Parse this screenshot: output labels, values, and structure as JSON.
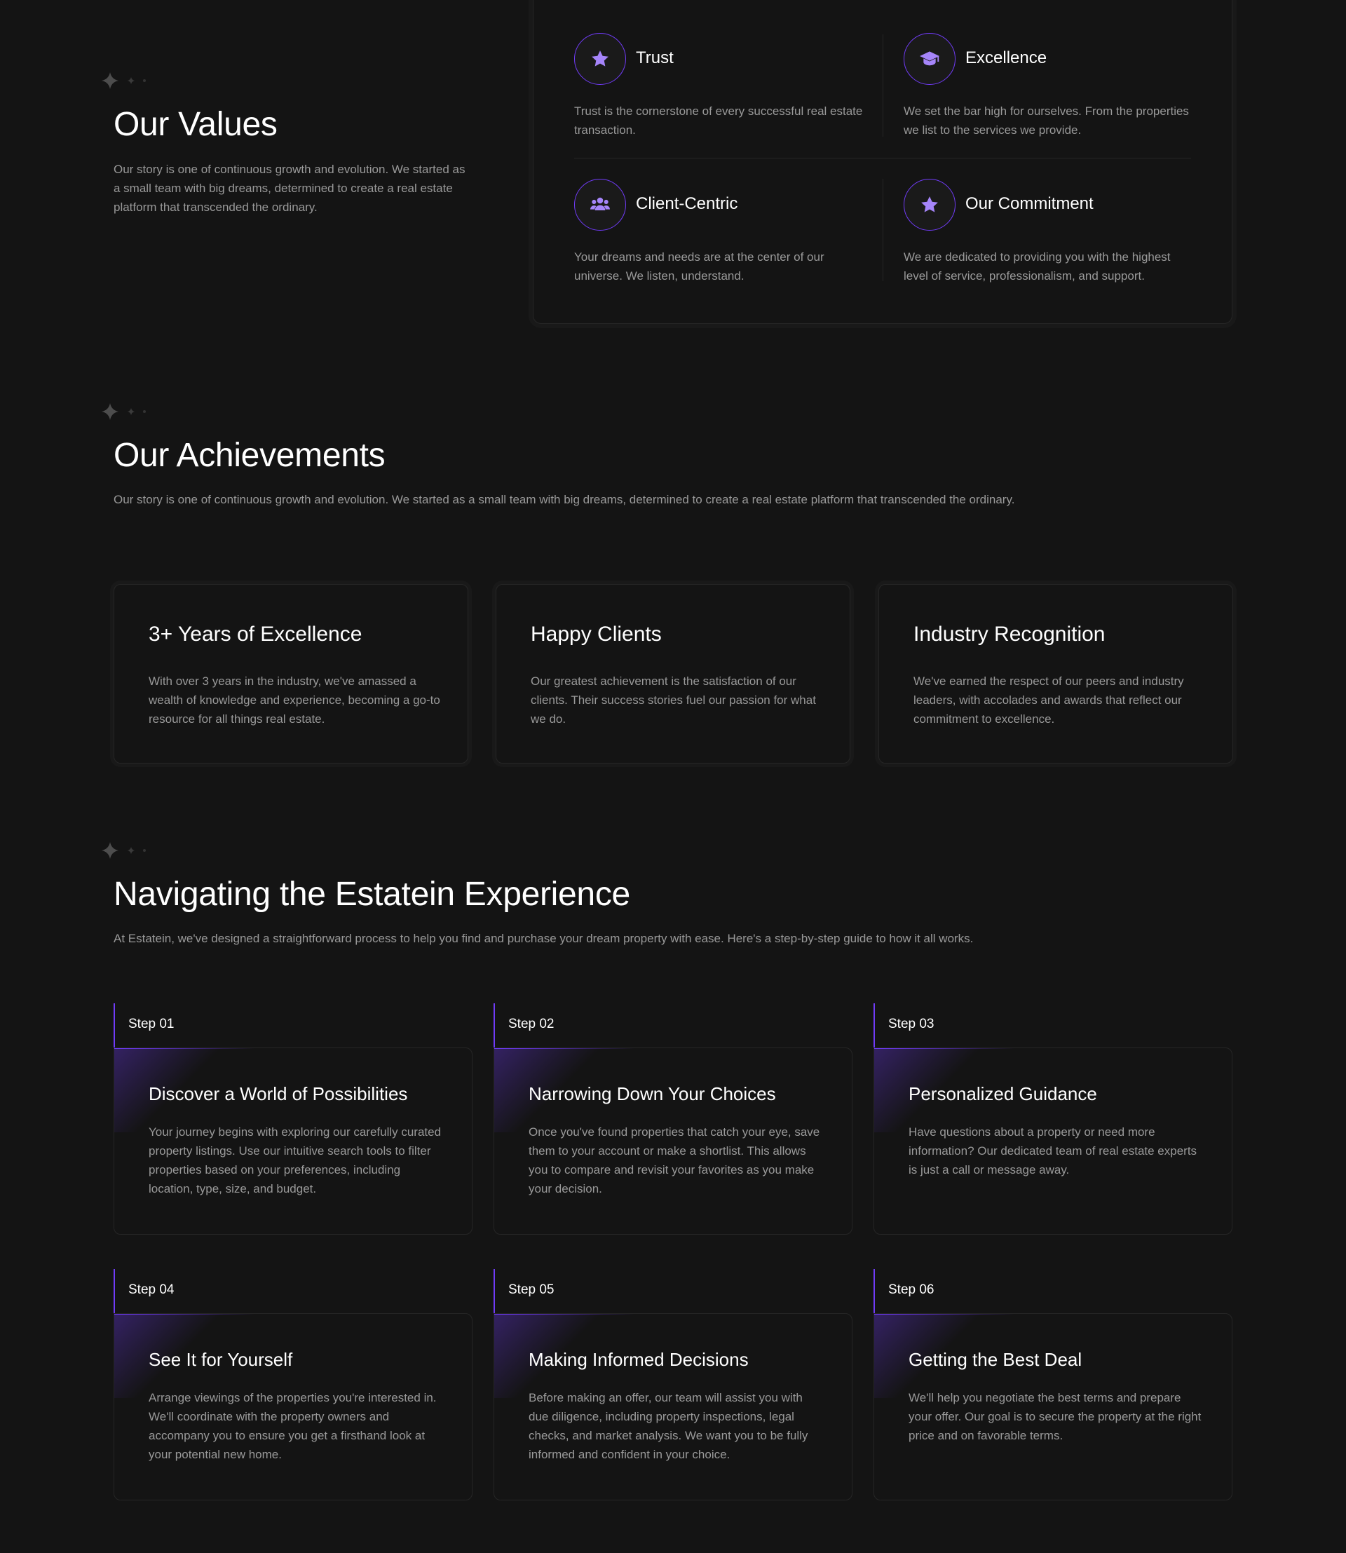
{
  "values": {
    "title": "Our Values",
    "description": "Our story is one of continuous growth and evolution. We started as a small team with big dreams, determined to create a real estate platform that transcended the ordinary.",
    "items": [
      {
        "icon": "star-icon",
        "title": "Trust",
        "description": "Trust is the cornerstone of every successful real estate transaction."
      },
      {
        "icon": "graduation-cap-icon",
        "title": "Excellence",
        "description": "We set the bar high for ourselves. From the properties we list to the services we provide."
      },
      {
        "icon": "users-icon",
        "title": "Client-Centric",
        "description": "Your dreams and needs are at the center of our universe. We listen, understand."
      },
      {
        "icon": "star-icon",
        "title": "Our Commitment",
        "description": "We are dedicated to providing you with the highest level of service, professionalism, and support."
      }
    ]
  },
  "achievements": {
    "title": "Our Achievements",
    "description": "Our story is one of continuous growth and evolution. We started as a small team with big dreams, determined to create a real estate platform that transcended the ordinary.",
    "items": [
      {
        "title": "3+ Years of Excellence",
        "description": "With over 3 years in the industry, we've amassed a wealth of knowledge and experience, becoming a go-to resource for all things real estate."
      },
      {
        "title": "Happy Clients",
        "description": "Our greatest achievement is the satisfaction of our clients. Their success stories fuel our passion for what we do."
      },
      {
        "title": "Industry Recognition",
        "description": "We've earned the respect of our peers and industry leaders, with accolades and awards that reflect our commitment to excellence."
      }
    ]
  },
  "experience": {
    "title": "Navigating the Estatein Experience",
    "description": "At Estatein, we've designed a straightforward process to help you find and purchase your dream property with ease. Here's a step-by-step guide to how it all works.",
    "steps": [
      {
        "label": "Step 01",
        "title": "Discover a World of Possibilities",
        "description": "Your journey begins with exploring our carefully curated property listings. Use our intuitive search tools to filter properties based on your preferences, including location, type, size, and budget."
      },
      {
        "label": "Step 02",
        "title": "Narrowing Down Your Choices",
        "description": "Once you've found properties that catch your eye, save them to your account or make a shortlist. This allows you to compare and revisit your favorites as you make your decision."
      },
      {
        "label": "Step 03",
        "title": "Personalized Guidance",
        "description": "Have questions about a property or need more information? Our dedicated team of real estate experts is just a call or message away."
      },
      {
        "label": "Step 04",
        "title": "See It for Yourself",
        "description": "Arrange viewings of the properties you're interested in. We'll coordinate with the property owners and accompany you to ensure you get a firsthand look at your potential new home."
      },
      {
        "label": "Step 05",
        "title": "Making Informed Decisions",
        "description": "Before making an offer, our team will assist you with due diligence, including property inspections, legal checks, and market analysis. We want you to be fully informed and confident in your choice."
      },
      {
        "label": "Step 06",
        "title": "Getting the Best Deal",
        "description": "We'll help you negotiate the best terms and prepare your offer. Our goal is to secure the property at the right price and on favorable terms."
      }
    ]
  },
  "colors": {
    "background": "#141414",
    "accent": "#703BF7",
    "icon_fill": "#A685FA",
    "muted_text": "#999999",
    "border": "#262626"
  }
}
